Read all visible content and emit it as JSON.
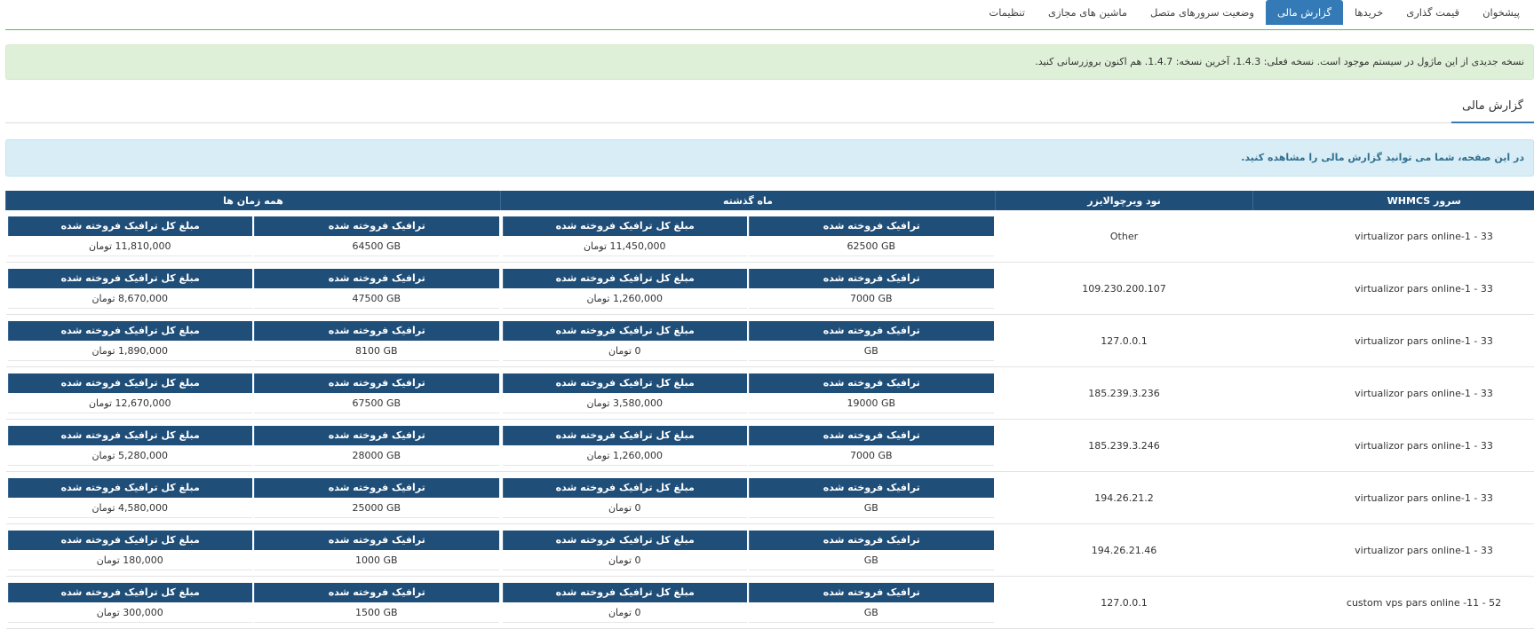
{
  "nav": {
    "tabs": [
      {
        "label": "پیشخوان",
        "active": false
      },
      {
        "label": "قیمت گذاری",
        "active": false
      },
      {
        "label": "خریدها",
        "active": false
      },
      {
        "label": "گزارش مالی",
        "active": true
      },
      {
        "label": "وضعیت سرورهای متصل",
        "active": false
      },
      {
        "label": "ماشین های مجازی",
        "active": false
      },
      {
        "label": "تنظیمات",
        "active": false
      }
    ]
  },
  "update_alert": {
    "text": "نسخه جدیدی از این ماژول در سیستم موجود است. نسخه فعلی: 1.4.3، آخرین نسخه: 1.4.7. هم اکنون بروزرسانی کنید."
  },
  "section": {
    "title": "گزارش مالی"
  },
  "info_alert": {
    "text": "در این صفحه، شما می توانید گزارش مالی را مشاهده کنید."
  },
  "table": {
    "headers": {
      "server": "سرور WHMCS",
      "node": "نود ویرچوالایزر",
      "last_month": "ماه گذشته",
      "all_time": "همه زمان ها"
    },
    "sub_headers": {
      "traffic": "ترافیک فروخته شده",
      "amount": "مبلغ کل ترافیک فروخته شده"
    },
    "rows": [
      {
        "server": "virtualizor pars online-1 - 33",
        "node": "Other",
        "month_traffic": "62500 GB",
        "month_amount": "11,450,000 تومان",
        "all_traffic": "64500 GB",
        "all_amount": "11,810,000 تومان"
      },
      {
        "server": "virtualizor pars online-1 - 33",
        "node": "109.230.200.107",
        "month_traffic": "7000 GB",
        "month_amount": "1,260,000 تومان",
        "all_traffic": "47500 GB",
        "all_amount": "8,670,000 تومان"
      },
      {
        "server": "virtualizor pars online-1 - 33",
        "node": "127.0.0.1",
        "month_traffic": "GB",
        "month_amount": "0 تومان",
        "all_traffic": "8100 GB",
        "all_amount": "1,890,000 تومان"
      },
      {
        "server": "virtualizor pars online-1 - 33",
        "node": "185.239.3.236",
        "month_traffic": "19000 GB",
        "month_amount": "3,580,000 تومان",
        "all_traffic": "67500 GB",
        "all_amount": "12,670,000 تومان"
      },
      {
        "server": "virtualizor pars online-1 - 33",
        "node": "185.239.3.246",
        "month_traffic": "7000 GB",
        "month_amount": "1,260,000 تومان",
        "all_traffic": "28000 GB",
        "all_amount": "5,280,000 تومان"
      },
      {
        "server": "virtualizor pars online-1 - 33",
        "node": "194.26.21.2",
        "month_traffic": "GB",
        "month_amount": "0 تومان",
        "all_traffic": "25000 GB",
        "all_amount": "4,580,000 تومان"
      },
      {
        "server": "virtualizor pars online-1 - 33",
        "node": "194.26.21.46",
        "month_traffic": "GB",
        "month_amount": "0 تومان",
        "all_traffic": "1000 GB",
        "all_amount": "180,000 تومان"
      },
      {
        "server": "custom vps pars online -11 - 52",
        "node": "127.0.0.1",
        "month_traffic": "GB",
        "month_amount": "0 تومان",
        "all_traffic": "1500 GB",
        "all_amount": "300,000 تومان"
      }
    ]
  },
  "colors": {
    "header_bg": "#1f4e79",
    "active_tab": "#337ab7",
    "success_bg": "#dff0d8",
    "info_bg": "#d9edf7"
  }
}
